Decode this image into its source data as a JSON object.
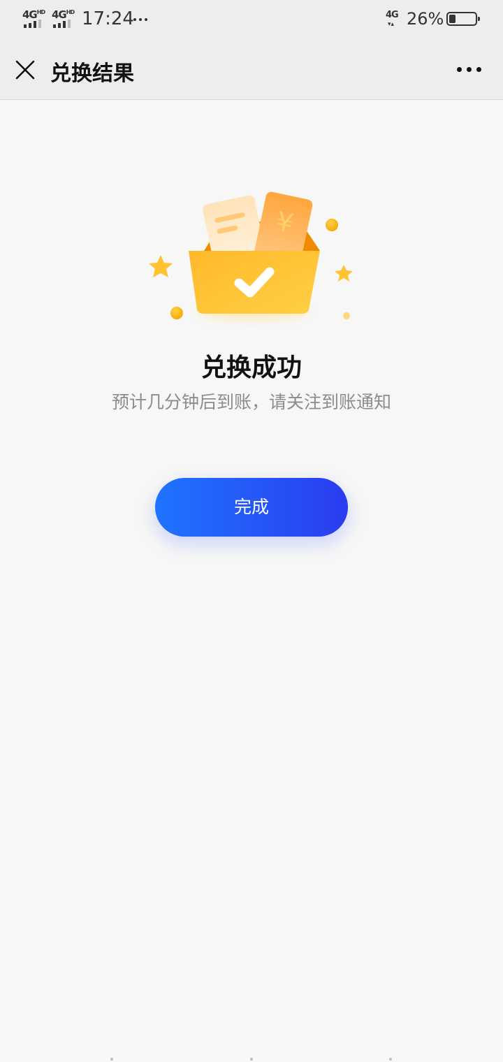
{
  "status_bar": {
    "sim1": "4G",
    "sim1_sup": "HD",
    "sim2": "4G",
    "sim2_sup": "HD",
    "time": "17:24",
    "network": "4G",
    "battery_percent_label": "26%",
    "battery_level": 0.26
  },
  "nav": {
    "title": "兑换结果",
    "close_icon": "close-icon",
    "more_icon": "more-dots-icon"
  },
  "illustration": {
    "icon": "gift-box-check-icon",
    "voucher_symbol": "¥"
  },
  "result": {
    "title": "兑换成功",
    "description": "预计几分钟后到账，请关注到账通知"
  },
  "actions": {
    "done_label": "完成"
  },
  "colors": {
    "button_gradient_start": "#1f74ff",
    "button_gradient_end": "#2a3cf0",
    "box_yellow": "#ffc233",
    "box_orange": "#f08a00",
    "page_background": "#f7f7f7",
    "bar_background": "#ededed"
  }
}
